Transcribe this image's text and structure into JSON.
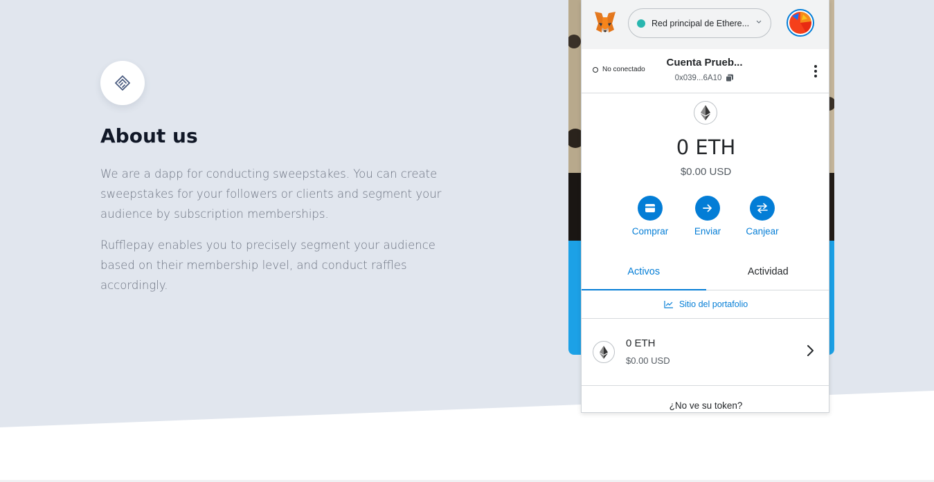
{
  "colors": {
    "page_band": "#e1e6ee",
    "accent_blue": "#037dd6",
    "card_blue": "#1ca1e6",
    "network_dot": "#29b6af"
  },
  "about": {
    "icon": "handshake-icon",
    "title": "About us",
    "paragraph_1": "We are a dapp for conducting sweepstakes. You can create sweepstakes for your followers or clients and segment your audience by subscription memberships.",
    "paragraph_2": "Rufflepay enables you to precisely segment your audience based on their membership level, and conduct raffles accordingly."
  },
  "wallet": {
    "header": {
      "logo_icon": "metamask-fox-icon",
      "network_label": "Red principal de Ethere...",
      "network_chevron": "chevron-down-icon",
      "avatar_icon": "account-avatar-icon"
    },
    "account": {
      "connection_status": "No conectado",
      "name": "Cuenta Prueb...",
      "address": "0x039...6A10",
      "copy_icon": "copy-icon",
      "menu_icon": "kebab-menu-icon"
    },
    "balance": {
      "amount": "0 ETH",
      "usd": "$0.00 USD"
    },
    "actions": [
      {
        "label": "Comprar",
        "icon": "card-icon"
      },
      {
        "label": "Enviar",
        "icon": "arrow-right-icon"
      },
      {
        "label": "Canjear",
        "icon": "swap-icon"
      }
    ],
    "tabs": [
      {
        "label": "Activos",
        "active": true
      },
      {
        "label": "Actividad",
        "active": false
      }
    ],
    "portfolio_link": "Sitio del portafolio",
    "assets": [
      {
        "amount": "0 ETH",
        "usd": "$0.00 USD",
        "icon": "ethereum-icon"
      }
    ],
    "no_token_link": "¿No ve su token?"
  }
}
